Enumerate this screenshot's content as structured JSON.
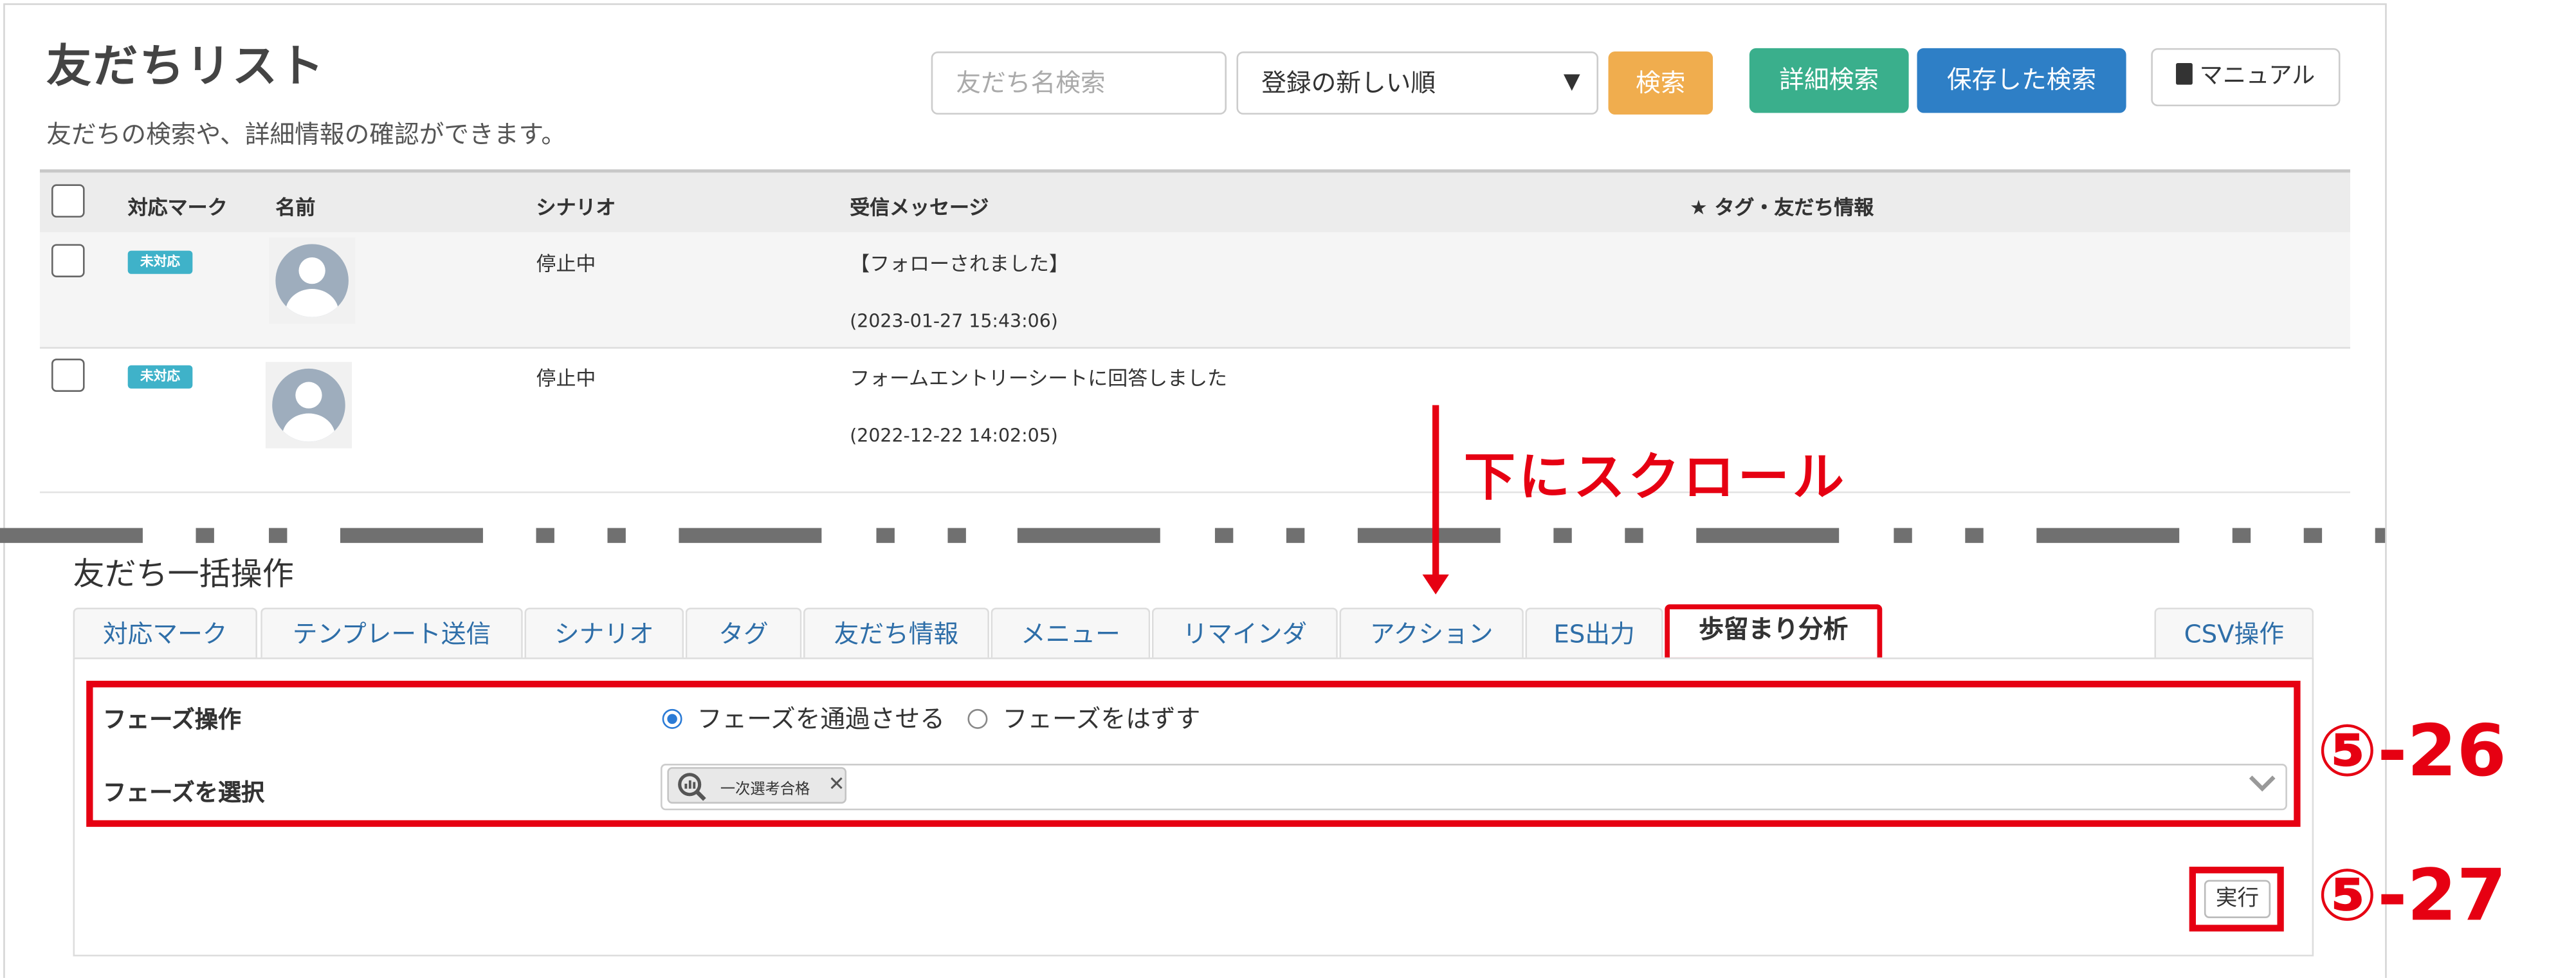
{
  "header": {
    "title": "友だちリスト",
    "subtitle": "友だちの検索や、詳細情報の確認ができます。"
  },
  "toolbar": {
    "search_placeholder": "友だち名検索",
    "sort_selected": "登録の新しい順",
    "search_button": "検索",
    "advanced_search_button": "詳細検索",
    "saved_search_button": "保存した検索",
    "manual_button": "マニュアル"
  },
  "table": {
    "columns": [
      "対応マーク",
      "名前",
      "シナリオ",
      "受信メッセージ",
      "★ タグ・友だち情報"
    ],
    "rows": [
      {
        "status": "未対応",
        "scenario": "停止中",
        "message": "【フォローされました】",
        "timestamp": "(2023-01-27 15:43:06)"
      },
      {
        "status": "未対応",
        "scenario": "停止中",
        "message": "フォームエントリーシートに回答しました",
        "timestamp": "(2022-12-22 14:02:05)"
      }
    ]
  },
  "annotation": {
    "scroll_hint": "下にスクロール",
    "label_26": "⑤-26",
    "label_27": "⑤-27"
  },
  "bulk": {
    "title": "友だち一括操作",
    "tabs": [
      "対応マーク",
      "テンプレート送信",
      "シナリオ",
      "タグ",
      "友だち情報",
      "メニュー",
      "リマインダ",
      "アクション",
      "ES出力",
      "歩留まり分析",
      "CSV操作"
    ],
    "active_tab": "歩留まり分析",
    "phase_operation_label": "フェーズ操作",
    "radio_pass": "フェーズを通過させる",
    "radio_remove": "フェーズをはずす",
    "phase_select_label": "フェーズを選択",
    "phase_chip": "一次選考合格",
    "execute_button": "実行"
  },
  "colors": {
    "accent_red": "#e60012",
    "search_orange": "#f0ad4e",
    "advanced_green": "#3aaf8c",
    "saved_blue": "#2e7fc6",
    "badge_teal": "#3fb2c9"
  }
}
